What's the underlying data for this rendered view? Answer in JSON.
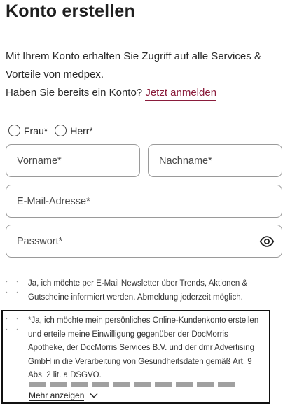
{
  "page": {
    "title": "Konto erstellen",
    "intro_line1": "Mit Ihrem Konto erhalten Sie Zugriff auf alle Services & Vorteile von medpex.",
    "intro_line2": "Haben Sie bereits ein Konto?",
    "login_link": "Jetzt anmelden"
  },
  "salutation": {
    "options": [
      "Frau*",
      "Herr*"
    ]
  },
  "fields": {
    "firstname_placeholder": "Vorname*",
    "lastname_placeholder": "Nachname*",
    "email_placeholder": "E-Mail-Adresse*",
    "password_placeholder": "Passwort*"
  },
  "newsletter": {
    "text": "Ja, ich möchte per E-Mail Newsletter über Trends, Aktionen & Gutscheine informiert werden. Abmeldung jederzeit möglich."
  },
  "consent": {
    "text": "*Ja, ich möchte mein persönliches Online-Kundenkonto erstellen und erteile meine Einwilligung gegenüber der DocMorris Apotheke, der DocMorris Services B.V. und der dmr Advertising GmbH in die Verarbeitung von Gesundheitsdaten gemäß Art. 9 Abs. 2 lit. a DSGVO.",
    "more_label": "Mehr anzeigen"
  },
  "icons": {
    "password_toggle": "eye-icon",
    "expand": "chevron-down-icon"
  },
  "colors": {
    "accent": "#8a1c3b",
    "border": "#9a9a9a",
    "text": "#222222"
  }
}
